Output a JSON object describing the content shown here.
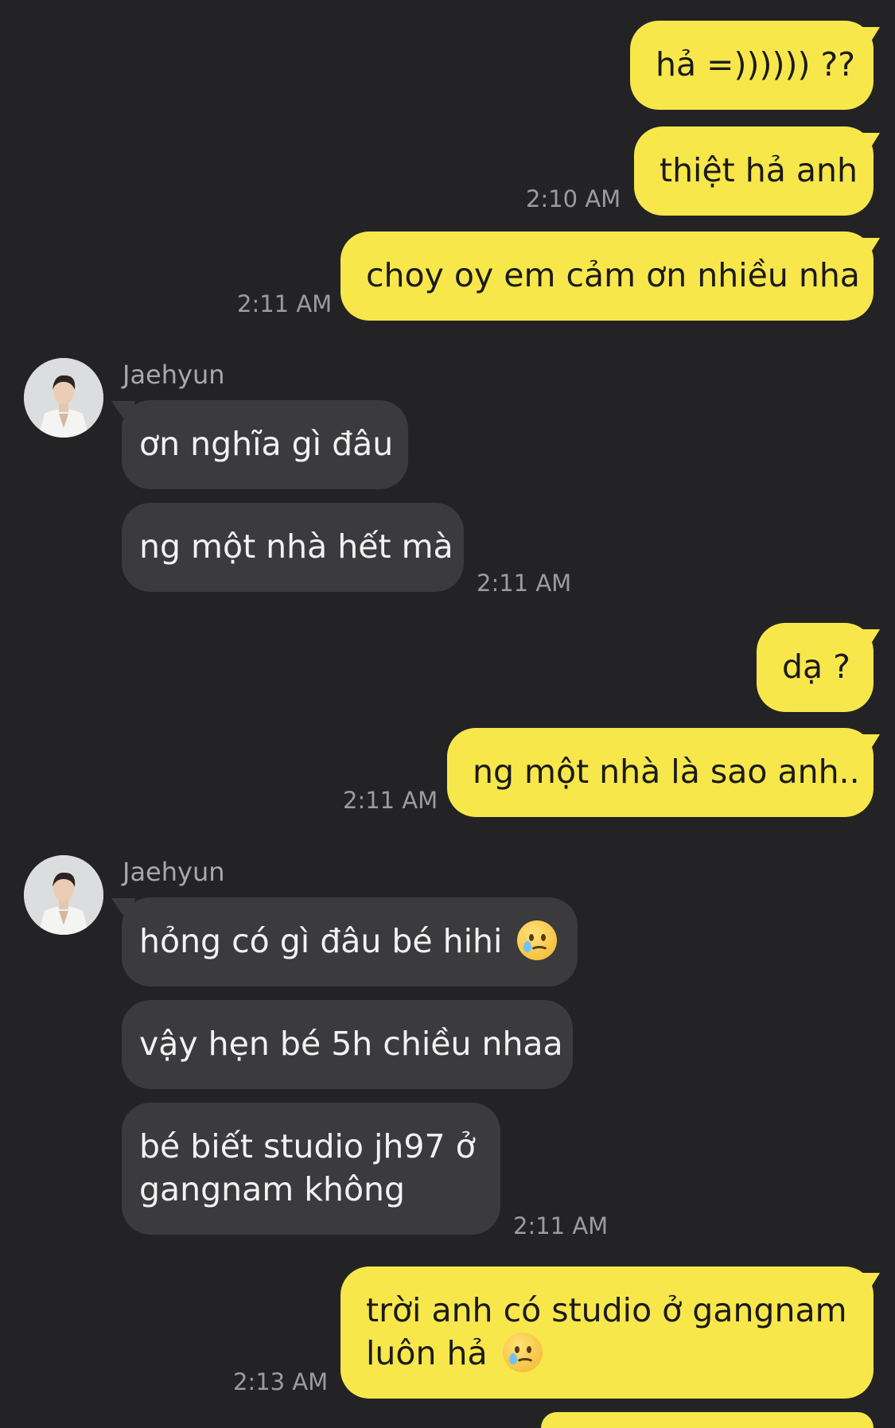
{
  "contact": {
    "name": "Jaehyun",
    "avatar_icon": "avatar-photo"
  },
  "colors": {
    "background": "#232325",
    "outgoing": "#F8E74A",
    "incoming": "#3B3B3D",
    "timestamp": "#9C9C9E"
  },
  "messages": [
    {
      "dir": "out",
      "text": "hả =)))))) ??"
    },
    {
      "dir": "out",
      "text": "thiệt hả anh",
      "time": "2:10 AM"
    },
    {
      "dir": "out",
      "text": "choy oy em cảm ơn nhiều nha",
      "time": "2:11 AM"
    },
    {
      "dir": "in",
      "sender": "Jaehyun",
      "text": "ơn nghĩa gì đâu"
    },
    {
      "dir": "in",
      "text": "ng một nhà hết mà",
      "time": "2:11 AM"
    },
    {
      "dir": "out",
      "text": "dạ ?"
    },
    {
      "dir": "out",
      "text": "ng một nhà là sao anh..",
      "time": "2:11 AM"
    },
    {
      "dir": "in",
      "sender": "Jaehyun",
      "text": "hỏng có gì đâu bé hihi",
      "emoji": "tearful-smile-emoji"
    },
    {
      "dir": "in",
      "text": "vậy hẹn bé 5h chiều nhaa"
    },
    {
      "dir": "in",
      "text": "bé biết studio jh97 ở gangnam không",
      "time": "2:11 AM"
    },
    {
      "dir": "out",
      "text": "trời anh có studio ở gangnam luôn hả",
      "emoji": "tearful-smile-emoji",
      "time": "2:13 AM"
    }
  ]
}
